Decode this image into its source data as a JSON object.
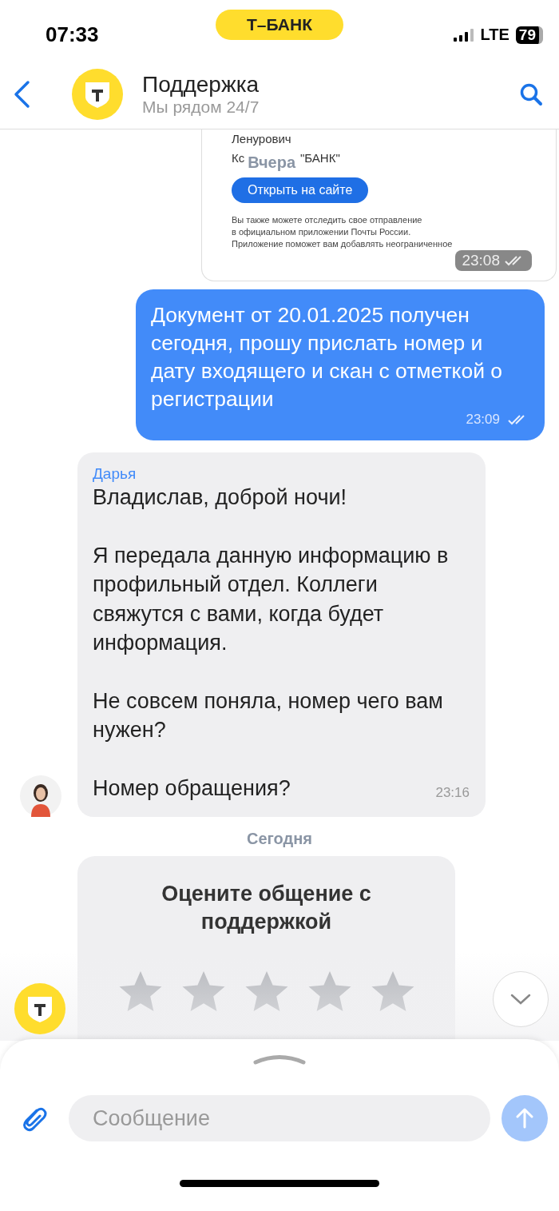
{
  "status_bar": {
    "time": "07:33",
    "brand": "Т–БАНК",
    "network": "LTE",
    "battery": "79"
  },
  "header": {
    "title": "Поддержка",
    "subtitle": "Мы рядом 24/7"
  },
  "messages": [
    {
      "kind": "document",
      "lines": [
        "Ленурович"
      ],
      "line_left": "Кс",
      "date_label": "Вчера",
      "line_right": "\"БАНК\"",
      "button": "Открыть на сайте",
      "paragraph": [
        "Вы также можете отследить свое отправление",
        "в официальном приложении Почты России.",
        "Приложение поможет вам добавлять неограниченное"
      ],
      "time": "23:08",
      "read": true
    },
    {
      "kind": "outgoing",
      "text": "Документ от 20.01.2025 получен сегодня, прошу прислать номер и дату входящего и скан с отметкой о регистрации",
      "time": "23:09",
      "read": true
    },
    {
      "kind": "incoming",
      "author": "Дарья",
      "paragraphs": [
        "Владислав, доброй ночи!",
        "Я передала данную информацию в профильный отдел. Коллеги свяжутся с вами, когда будет информация.",
        "Не совсем поняла, номер чего вам нужен?",
        "Номер обращения?"
      ],
      "time": "23:16"
    },
    {
      "kind": "date",
      "text": "Сегодня"
    },
    {
      "kind": "rating",
      "title": "Оцените общение с поддержкой",
      "stars": 0
    }
  ],
  "composer": {
    "placeholder": "Сообщение"
  }
}
